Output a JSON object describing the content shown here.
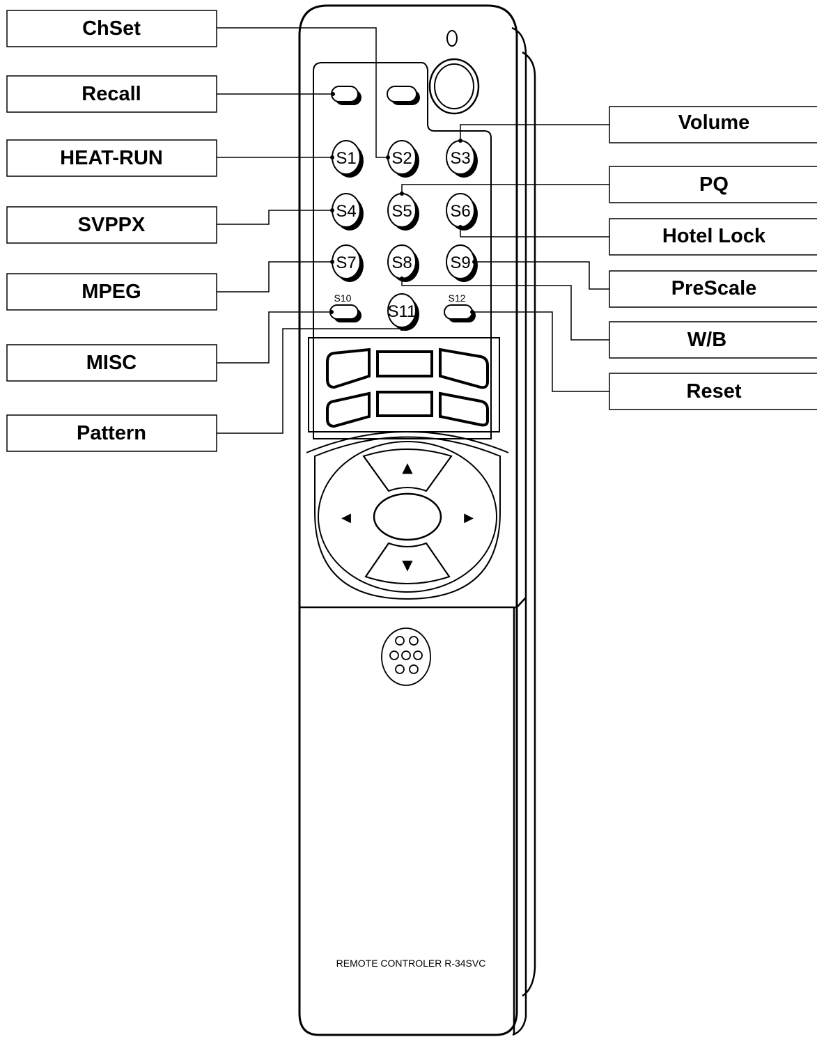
{
  "labels_left": {
    "chset": "ChSet",
    "recall": "Recall",
    "heat_run": "HEAT-RUN",
    "svppx": "SVPPX",
    "mpeg": "MPEG",
    "misc": "MISC",
    "pattern": "Pattern"
  },
  "labels_right": {
    "volume": "Volume",
    "pq": "PQ",
    "hotel_lock": "Hotel Lock",
    "prescale": "PreScale",
    "wb": "W/B",
    "reset": "Reset"
  },
  "buttons": {
    "s1": "S1",
    "s2": "S2",
    "s3": "S3",
    "s4": "S4",
    "s5": "S5",
    "s6": "S6",
    "s7": "S7",
    "s8": "S8",
    "s9": "S9",
    "s10": "S10",
    "s11": "S11",
    "s12": "S12"
  },
  "dpad": {
    "up": "▲",
    "down": "▼",
    "left": "◀",
    "right": "▶"
  },
  "model_text": "REMOTE CONTROLER R-34SVC"
}
